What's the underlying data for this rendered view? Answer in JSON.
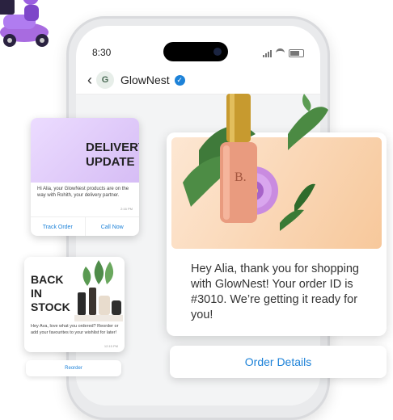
{
  "status_bar": {
    "time": "8:30"
  },
  "header": {
    "back_icon": "‹",
    "logo_letter": "G",
    "brand": "GlowNest",
    "verified_icon": "✓"
  },
  "delivery_card": {
    "title_line1": "DELIVERY",
    "title_line2": "UPDATE",
    "text": "Hi Alia, your GlowNest products are on the way with Rohith, your delivery partner.",
    "time": "2:16 PM",
    "buttons": [
      "Track Order",
      "Call Now"
    ]
  },
  "stock_card": {
    "title_line1": "BACK",
    "title_line2": "IN",
    "title_line3": "STOCK",
    "text": "Hey Ava, love what you ordered? Reorder or add your favourites to your wishlist for later!",
    "time": "12:15 PM",
    "button": "Reorder"
  },
  "main_card": {
    "message": "Hey Alia, thank you for shopping with GlowNest! Your order ID is #3010. We’re getting it ready for you!",
    "bottle_letter": "B.",
    "button": "Order Details"
  },
  "colors": {
    "accent": "#1d82d8",
    "verified": "#1d82d8"
  }
}
